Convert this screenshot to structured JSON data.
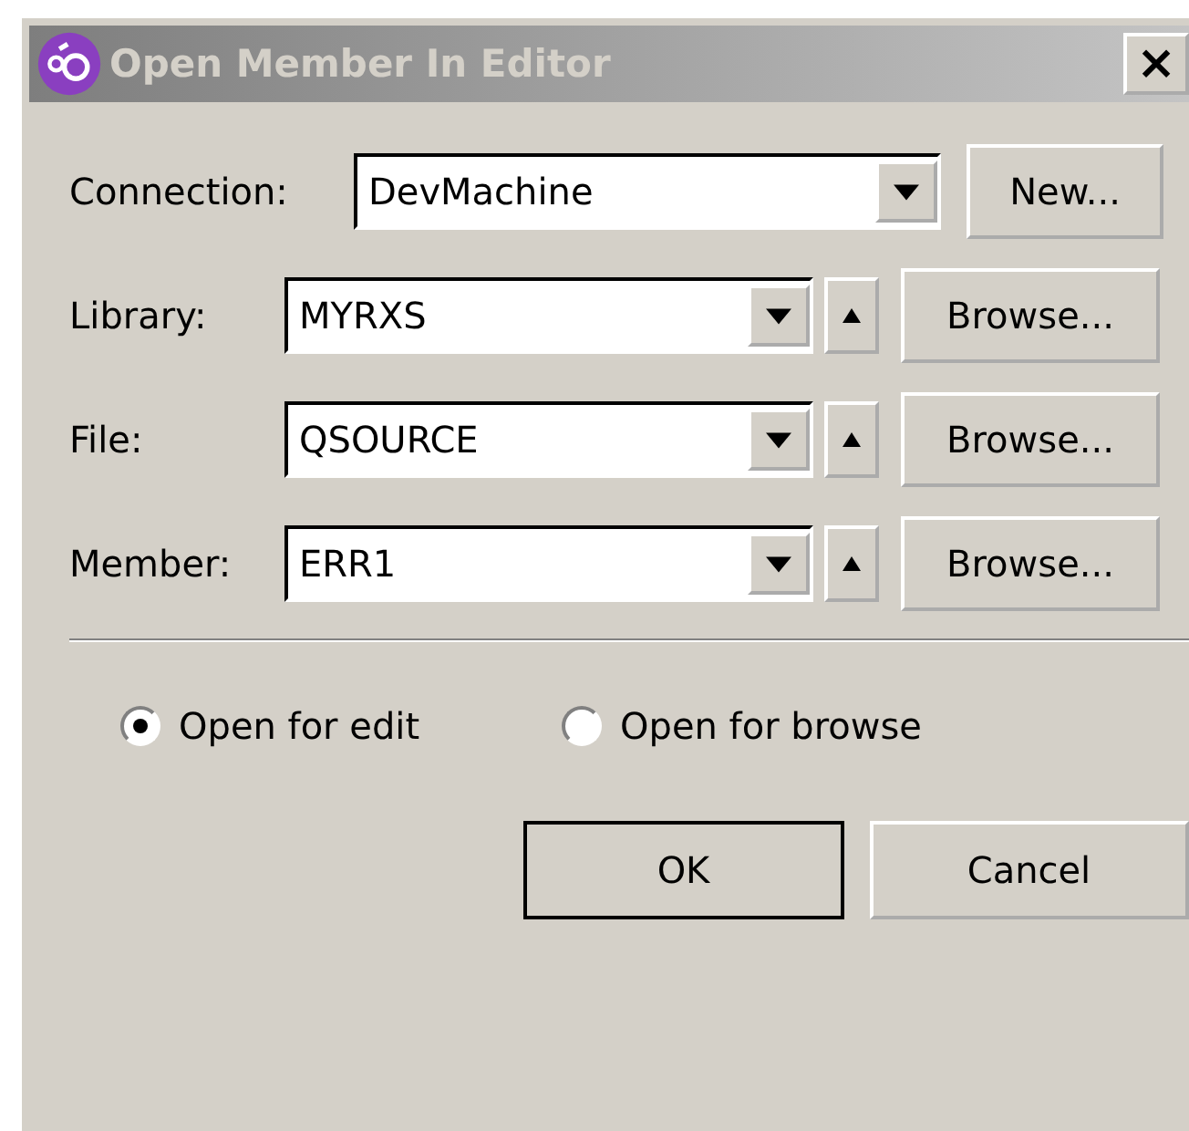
{
  "window": {
    "title": "Open Member In Editor",
    "close": "×"
  },
  "connection": {
    "label": "Connection:",
    "value": "DevMachine",
    "button": "New..."
  },
  "rows": [
    {
      "label": "Library:",
      "value": "MYRXS",
      "button": "Browse..."
    },
    {
      "label": "File:",
      "value": "QSOURCE",
      "button": "Browse..."
    },
    {
      "label": "Member:",
      "value": "ERR1",
      "button": "Browse..."
    }
  ],
  "options": [
    {
      "label": "Open for edit",
      "selected": true
    },
    {
      "label": "Open for browse",
      "selected": false
    }
  ],
  "buttons": [
    {
      "label": "OK",
      "default": true
    },
    {
      "label": "Cancel",
      "default": false
    }
  ]
}
